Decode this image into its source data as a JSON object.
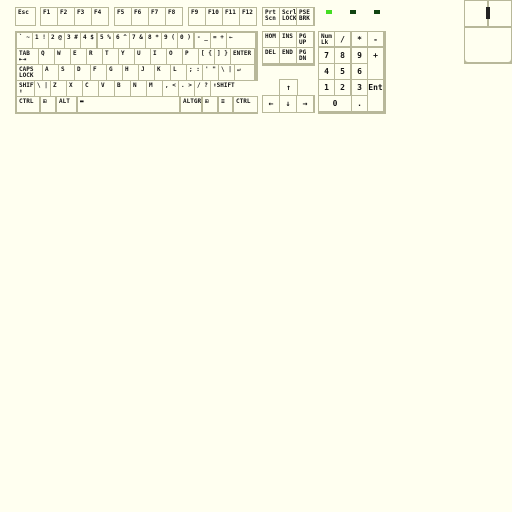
{
  "function_row": {
    "esc": "Esc",
    "groups": [
      [
        "F1",
        "F2",
        "F3",
        "F4"
      ],
      [
        "F5",
        "F6",
        "F7",
        "F8"
      ],
      [
        "F9",
        "F10",
        "F11",
        "F12"
      ]
    ],
    "system": [
      "Prt\nScn",
      "Scrl\nLOCK",
      "PSE\nBRK"
    ]
  },
  "leds": {
    "colors": [
      "#44dd22",
      "#114411",
      "#114411"
    ],
    "states": [
      "on",
      "off",
      "off"
    ]
  },
  "main": {
    "rows": [
      [
        "` ~",
        "1 !",
        "2 @",
        "3 #",
        "4 $",
        "5 %",
        "6 ^",
        "7 &",
        "8 *",
        "9 (",
        "0 )",
        "- _",
        "= +",
        "←"
      ],
      [
        "TAB\n⇤⇥",
        "Q",
        "W",
        "E",
        "R",
        "T",
        "Y",
        "U",
        "I",
        "O",
        "P",
        "[ {",
        "] }",
        "ENTER"
      ],
      [
        "CAPS\nLOCK",
        "A",
        "S",
        "D",
        "F",
        "G",
        "H",
        "J",
        "K",
        "L",
        "; :",
        "' \"",
        "\\ |",
        "↵"
      ],
      [
        "SHIFT\n⬆",
        "\\ |",
        "Z",
        "X",
        "C",
        "V",
        "B",
        "N",
        "M",
        ", <",
        ". >",
        "/ ?",
        "⬆SHIFT"
      ],
      [
        "CTRL",
        "⊞",
        "ALT",
        "▬",
        "ALTGR",
        "⊞",
        "≡",
        "CTRL"
      ]
    ]
  },
  "navigation": {
    "keys": [
      "HOM",
      "INS",
      "PG\nUP",
      "DEL",
      "END",
      "PG\nDN"
    ],
    "arrows": [
      "↑",
      "←",
      "↓",
      "→"
    ]
  },
  "numpad": {
    "keys": [
      "Num\nLk",
      "/",
      "*",
      "-",
      "7",
      "8",
      "9",
      "+",
      "4",
      "5",
      "6",
      "1",
      "2",
      "3",
      "Ent",
      "0",
      "."
    ]
  },
  "mouse": {
    "buttons": [
      "left",
      "right"
    ],
    "wheel": "scroll-wheel"
  }
}
